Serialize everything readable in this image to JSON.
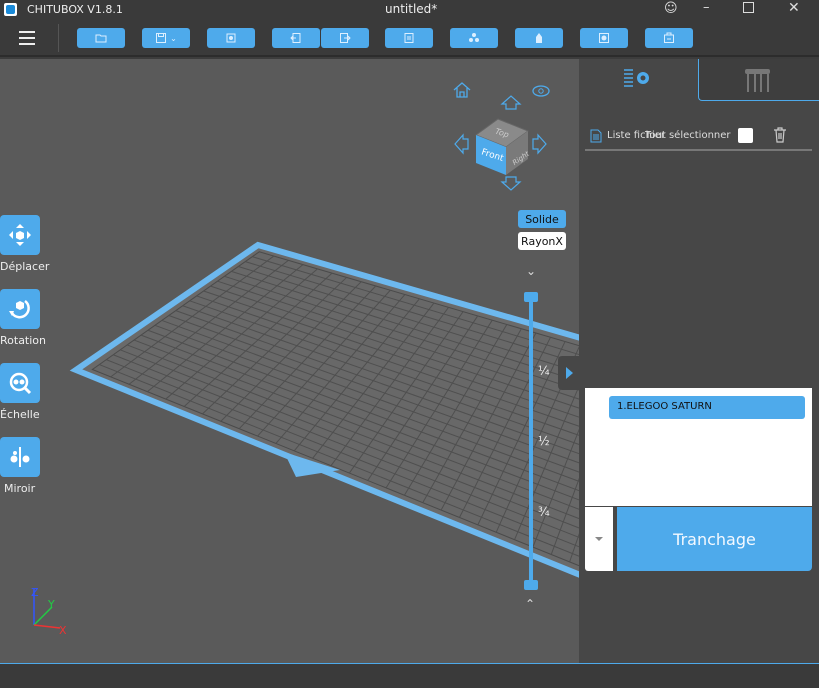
{
  "app": {
    "title": "CHITUBOX V1.8.1",
    "document": "untitled*"
  },
  "toolbar": {
    "buttons": [
      "open-file",
      "save",
      "auto-layout",
      "import",
      "export",
      "slice-settings",
      "supports",
      "hollow",
      "drill",
      "print-settings"
    ]
  },
  "tools": [
    {
      "label": "Déplacer"
    },
    {
      "label": "Rotation"
    },
    {
      "label": "Échelle"
    },
    {
      "label": "Miroir"
    }
  ],
  "view": {
    "cube_faces": {
      "top": "Top",
      "front": "Front",
      "right": "Right"
    },
    "modes": {
      "solid": "Solide",
      "xray": "RayonX"
    },
    "slider_marks": [
      "¼",
      "½",
      "¾"
    ],
    "axes": {
      "x": "X",
      "y": "Y",
      "z": "Z"
    }
  },
  "panel": {
    "file_list_label": "Liste fichier",
    "select_all_label": "Tout sélectionner",
    "printer": "1.ELEGOO SATURN",
    "slice_button": "Tranchage"
  },
  "colors": {
    "accent": "#4eaaeb",
    "viewport": "#5a5a5a",
    "panel": "#474747"
  }
}
